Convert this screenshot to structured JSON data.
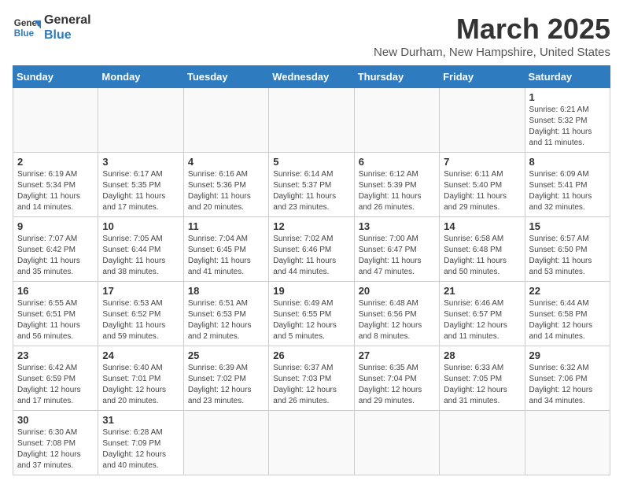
{
  "logo": {
    "text_general": "General",
    "text_blue": "Blue"
  },
  "title": "March 2025",
  "location": "New Durham, New Hampshire, United States",
  "weekdays": [
    "Sunday",
    "Monday",
    "Tuesday",
    "Wednesday",
    "Thursday",
    "Friday",
    "Saturday"
  ],
  "weeks": [
    [
      {
        "day": "",
        "info": ""
      },
      {
        "day": "",
        "info": ""
      },
      {
        "day": "",
        "info": ""
      },
      {
        "day": "",
        "info": ""
      },
      {
        "day": "",
        "info": ""
      },
      {
        "day": "",
        "info": ""
      },
      {
        "day": "1",
        "info": "Sunrise: 6:21 AM\nSunset: 5:32 PM\nDaylight: 11 hours and 11 minutes."
      }
    ],
    [
      {
        "day": "2",
        "info": "Sunrise: 6:19 AM\nSunset: 5:34 PM\nDaylight: 11 hours and 14 minutes."
      },
      {
        "day": "3",
        "info": "Sunrise: 6:17 AM\nSunset: 5:35 PM\nDaylight: 11 hours and 17 minutes."
      },
      {
        "day": "4",
        "info": "Sunrise: 6:16 AM\nSunset: 5:36 PM\nDaylight: 11 hours and 20 minutes."
      },
      {
        "day": "5",
        "info": "Sunrise: 6:14 AM\nSunset: 5:37 PM\nDaylight: 11 hours and 23 minutes."
      },
      {
        "day": "6",
        "info": "Sunrise: 6:12 AM\nSunset: 5:39 PM\nDaylight: 11 hours and 26 minutes."
      },
      {
        "day": "7",
        "info": "Sunrise: 6:11 AM\nSunset: 5:40 PM\nDaylight: 11 hours and 29 minutes."
      },
      {
        "day": "8",
        "info": "Sunrise: 6:09 AM\nSunset: 5:41 PM\nDaylight: 11 hours and 32 minutes."
      }
    ],
    [
      {
        "day": "9",
        "info": "Sunrise: 7:07 AM\nSunset: 6:42 PM\nDaylight: 11 hours and 35 minutes."
      },
      {
        "day": "10",
        "info": "Sunrise: 7:05 AM\nSunset: 6:44 PM\nDaylight: 11 hours and 38 minutes."
      },
      {
        "day": "11",
        "info": "Sunrise: 7:04 AM\nSunset: 6:45 PM\nDaylight: 11 hours and 41 minutes."
      },
      {
        "day": "12",
        "info": "Sunrise: 7:02 AM\nSunset: 6:46 PM\nDaylight: 11 hours and 44 minutes."
      },
      {
        "day": "13",
        "info": "Sunrise: 7:00 AM\nSunset: 6:47 PM\nDaylight: 11 hours and 47 minutes."
      },
      {
        "day": "14",
        "info": "Sunrise: 6:58 AM\nSunset: 6:48 PM\nDaylight: 11 hours and 50 minutes."
      },
      {
        "day": "15",
        "info": "Sunrise: 6:57 AM\nSunset: 6:50 PM\nDaylight: 11 hours and 53 minutes."
      }
    ],
    [
      {
        "day": "16",
        "info": "Sunrise: 6:55 AM\nSunset: 6:51 PM\nDaylight: 11 hours and 56 minutes."
      },
      {
        "day": "17",
        "info": "Sunrise: 6:53 AM\nSunset: 6:52 PM\nDaylight: 11 hours and 59 minutes."
      },
      {
        "day": "18",
        "info": "Sunrise: 6:51 AM\nSunset: 6:53 PM\nDaylight: 12 hours and 2 minutes."
      },
      {
        "day": "19",
        "info": "Sunrise: 6:49 AM\nSunset: 6:55 PM\nDaylight: 12 hours and 5 minutes."
      },
      {
        "day": "20",
        "info": "Sunrise: 6:48 AM\nSunset: 6:56 PM\nDaylight: 12 hours and 8 minutes."
      },
      {
        "day": "21",
        "info": "Sunrise: 6:46 AM\nSunset: 6:57 PM\nDaylight: 12 hours and 11 minutes."
      },
      {
        "day": "22",
        "info": "Sunrise: 6:44 AM\nSunset: 6:58 PM\nDaylight: 12 hours and 14 minutes."
      }
    ],
    [
      {
        "day": "23",
        "info": "Sunrise: 6:42 AM\nSunset: 6:59 PM\nDaylight: 12 hours and 17 minutes."
      },
      {
        "day": "24",
        "info": "Sunrise: 6:40 AM\nSunset: 7:01 PM\nDaylight: 12 hours and 20 minutes."
      },
      {
        "day": "25",
        "info": "Sunrise: 6:39 AM\nSunset: 7:02 PM\nDaylight: 12 hours and 23 minutes."
      },
      {
        "day": "26",
        "info": "Sunrise: 6:37 AM\nSunset: 7:03 PM\nDaylight: 12 hours and 26 minutes."
      },
      {
        "day": "27",
        "info": "Sunrise: 6:35 AM\nSunset: 7:04 PM\nDaylight: 12 hours and 29 minutes."
      },
      {
        "day": "28",
        "info": "Sunrise: 6:33 AM\nSunset: 7:05 PM\nDaylight: 12 hours and 31 minutes."
      },
      {
        "day": "29",
        "info": "Sunrise: 6:32 AM\nSunset: 7:06 PM\nDaylight: 12 hours and 34 minutes."
      }
    ],
    [
      {
        "day": "30",
        "info": "Sunrise: 6:30 AM\nSunset: 7:08 PM\nDaylight: 12 hours and 37 minutes."
      },
      {
        "day": "31",
        "info": "Sunrise: 6:28 AM\nSunset: 7:09 PM\nDaylight: 12 hours and 40 minutes."
      },
      {
        "day": "",
        "info": ""
      },
      {
        "day": "",
        "info": ""
      },
      {
        "day": "",
        "info": ""
      },
      {
        "day": "",
        "info": ""
      },
      {
        "day": "",
        "info": ""
      }
    ]
  ]
}
